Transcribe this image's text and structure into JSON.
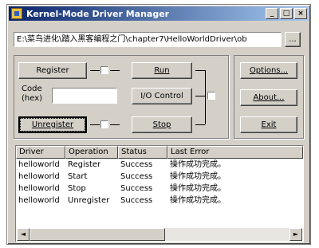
{
  "window": {
    "title": "Kernel-Mode Driver Manager"
  },
  "titlebar": {
    "minimize": "_",
    "maximize": "□",
    "close": "×"
  },
  "path": {
    "value": "E:\\菜鸟进化\\踏入黑客编程之门\\chapter7\\HelloWorldDriver\\ob",
    "browse_label": "..."
  },
  "actions": {
    "register": "Register",
    "run": "Run",
    "code_label_line1": "Code",
    "code_label_line2": "(hex)",
    "code_value": "",
    "io_control": "I/O Control",
    "unregister": "Unregister",
    "stop": "Stop"
  },
  "side": {
    "options": "Options...",
    "about": "About...",
    "exit": "Exit"
  },
  "table": {
    "columns": [
      "Driver",
      "Operation",
      "Status",
      "Last Error"
    ],
    "rows": [
      [
        "helloworld",
        "Register",
        "Success",
        "操作成功完成。"
      ],
      [
        "helloworld",
        "Start",
        "Success",
        "操作成功完成。"
      ],
      [
        "helloworld",
        "Stop",
        "Success",
        "操作成功完成。"
      ],
      [
        "helloworld",
        "Unregister",
        "Success",
        "操作成功完成。"
      ]
    ]
  },
  "scrollbar": {
    "left": "◄",
    "right": "►"
  }
}
